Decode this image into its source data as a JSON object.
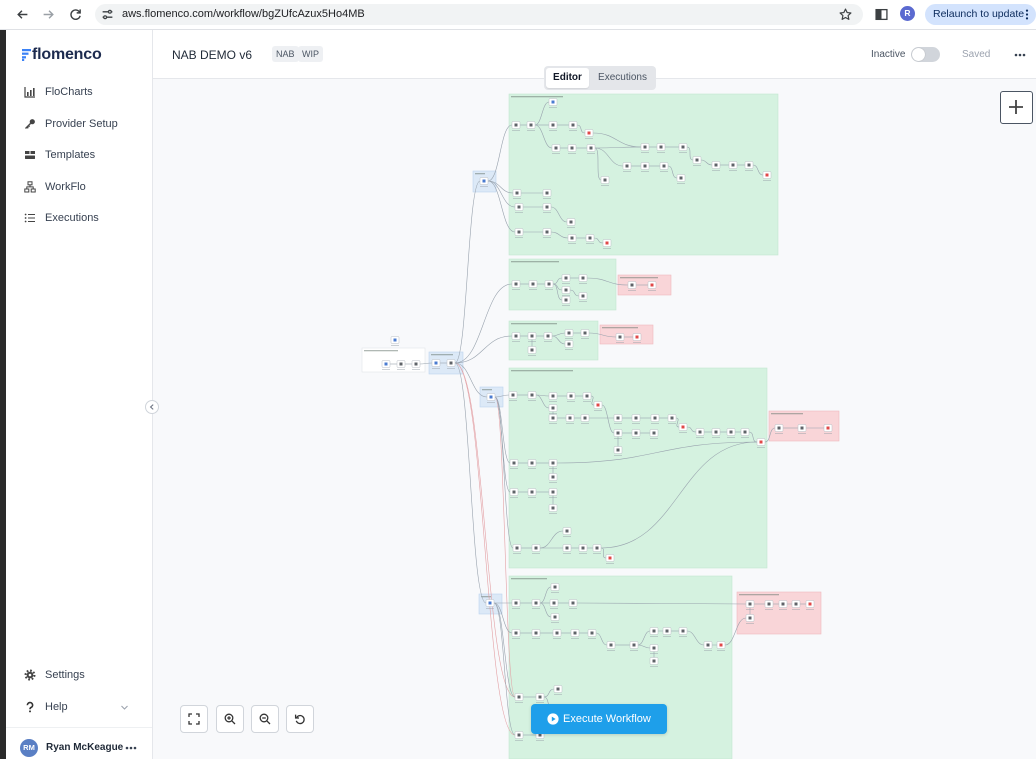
{
  "browser": {
    "url": "aws.flomenco.com/workflow/bgZUfcAzux5Ho4MB",
    "profile_initial": "R",
    "relaunch_label": "Relaunch to update",
    "icons": [
      "arrow-left-icon",
      "arrow-right-icon",
      "reload-icon",
      "site-settings-icon",
      "star-icon",
      "side-panel-icon",
      "kebab-menu-icon"
    ]
  },
  "sidebar": {
    "logo_text": "flomenco",
    "nav": [
      {
        "label": "FloCharts",
        "icon": "bar-chart-icon"
      },
      {
        "label": "Provider Setup",
        "icon": "key-icon"
      },
      {
        "label": "Templates",
        "icon": "templates-icon"
      },
      {
        "label": "WorkFlo",
        "icon": "workflow-icon"
      },
      {
        "label": "Executions",
        "icon": "list-icon"
      }
    ],
    "settings": {
      "label": "Settings",
      "icon": "gear-icon"
    },
    "help": {
      "label": "Help",
      "icon": "question-icon"
    },
    "user": {
      "initials": "RM",
      "name": "Ryan McKeague"
    }
  },
  "header": {
    "title": "NAB DEMO v6",
    "tags": [
      "NAB",
      "WIP"
    ],
    "status_label": "Inactive",
    "is_active": false,
    "save_status": "Saved"
  },
  "view_tabs": [
    {
      "label": "Editor",
      "active": true
    },
    {
      "label": "Executions",
      "active": false
    }
  ],
  "canvas": {
    "execute_label": "Execute Workflow",
    "controls": [
      "fullscreen-icon",
      "zoom-in-icon",
      "zoom-out-icon",
      "undo-icon"
    ],
    "add_node_icon": "plus-icon"
  },
  "colors": {
    "accent": "#1e9fea",
    "brand": "#1d2b4f",
    "group_green": "#d5f2e0",
    "group_red": "#f9d5d8",
    "group_blue": "#dce9f7",
    "edge": "#98a2ad",
    "edge_alert": "#e3a0a4",
    "node_icon_red": "#e04848",
    "node_icon_blue": "#4a7bd0",
    "node_icon_gray": "#5f6368"
  }
}
